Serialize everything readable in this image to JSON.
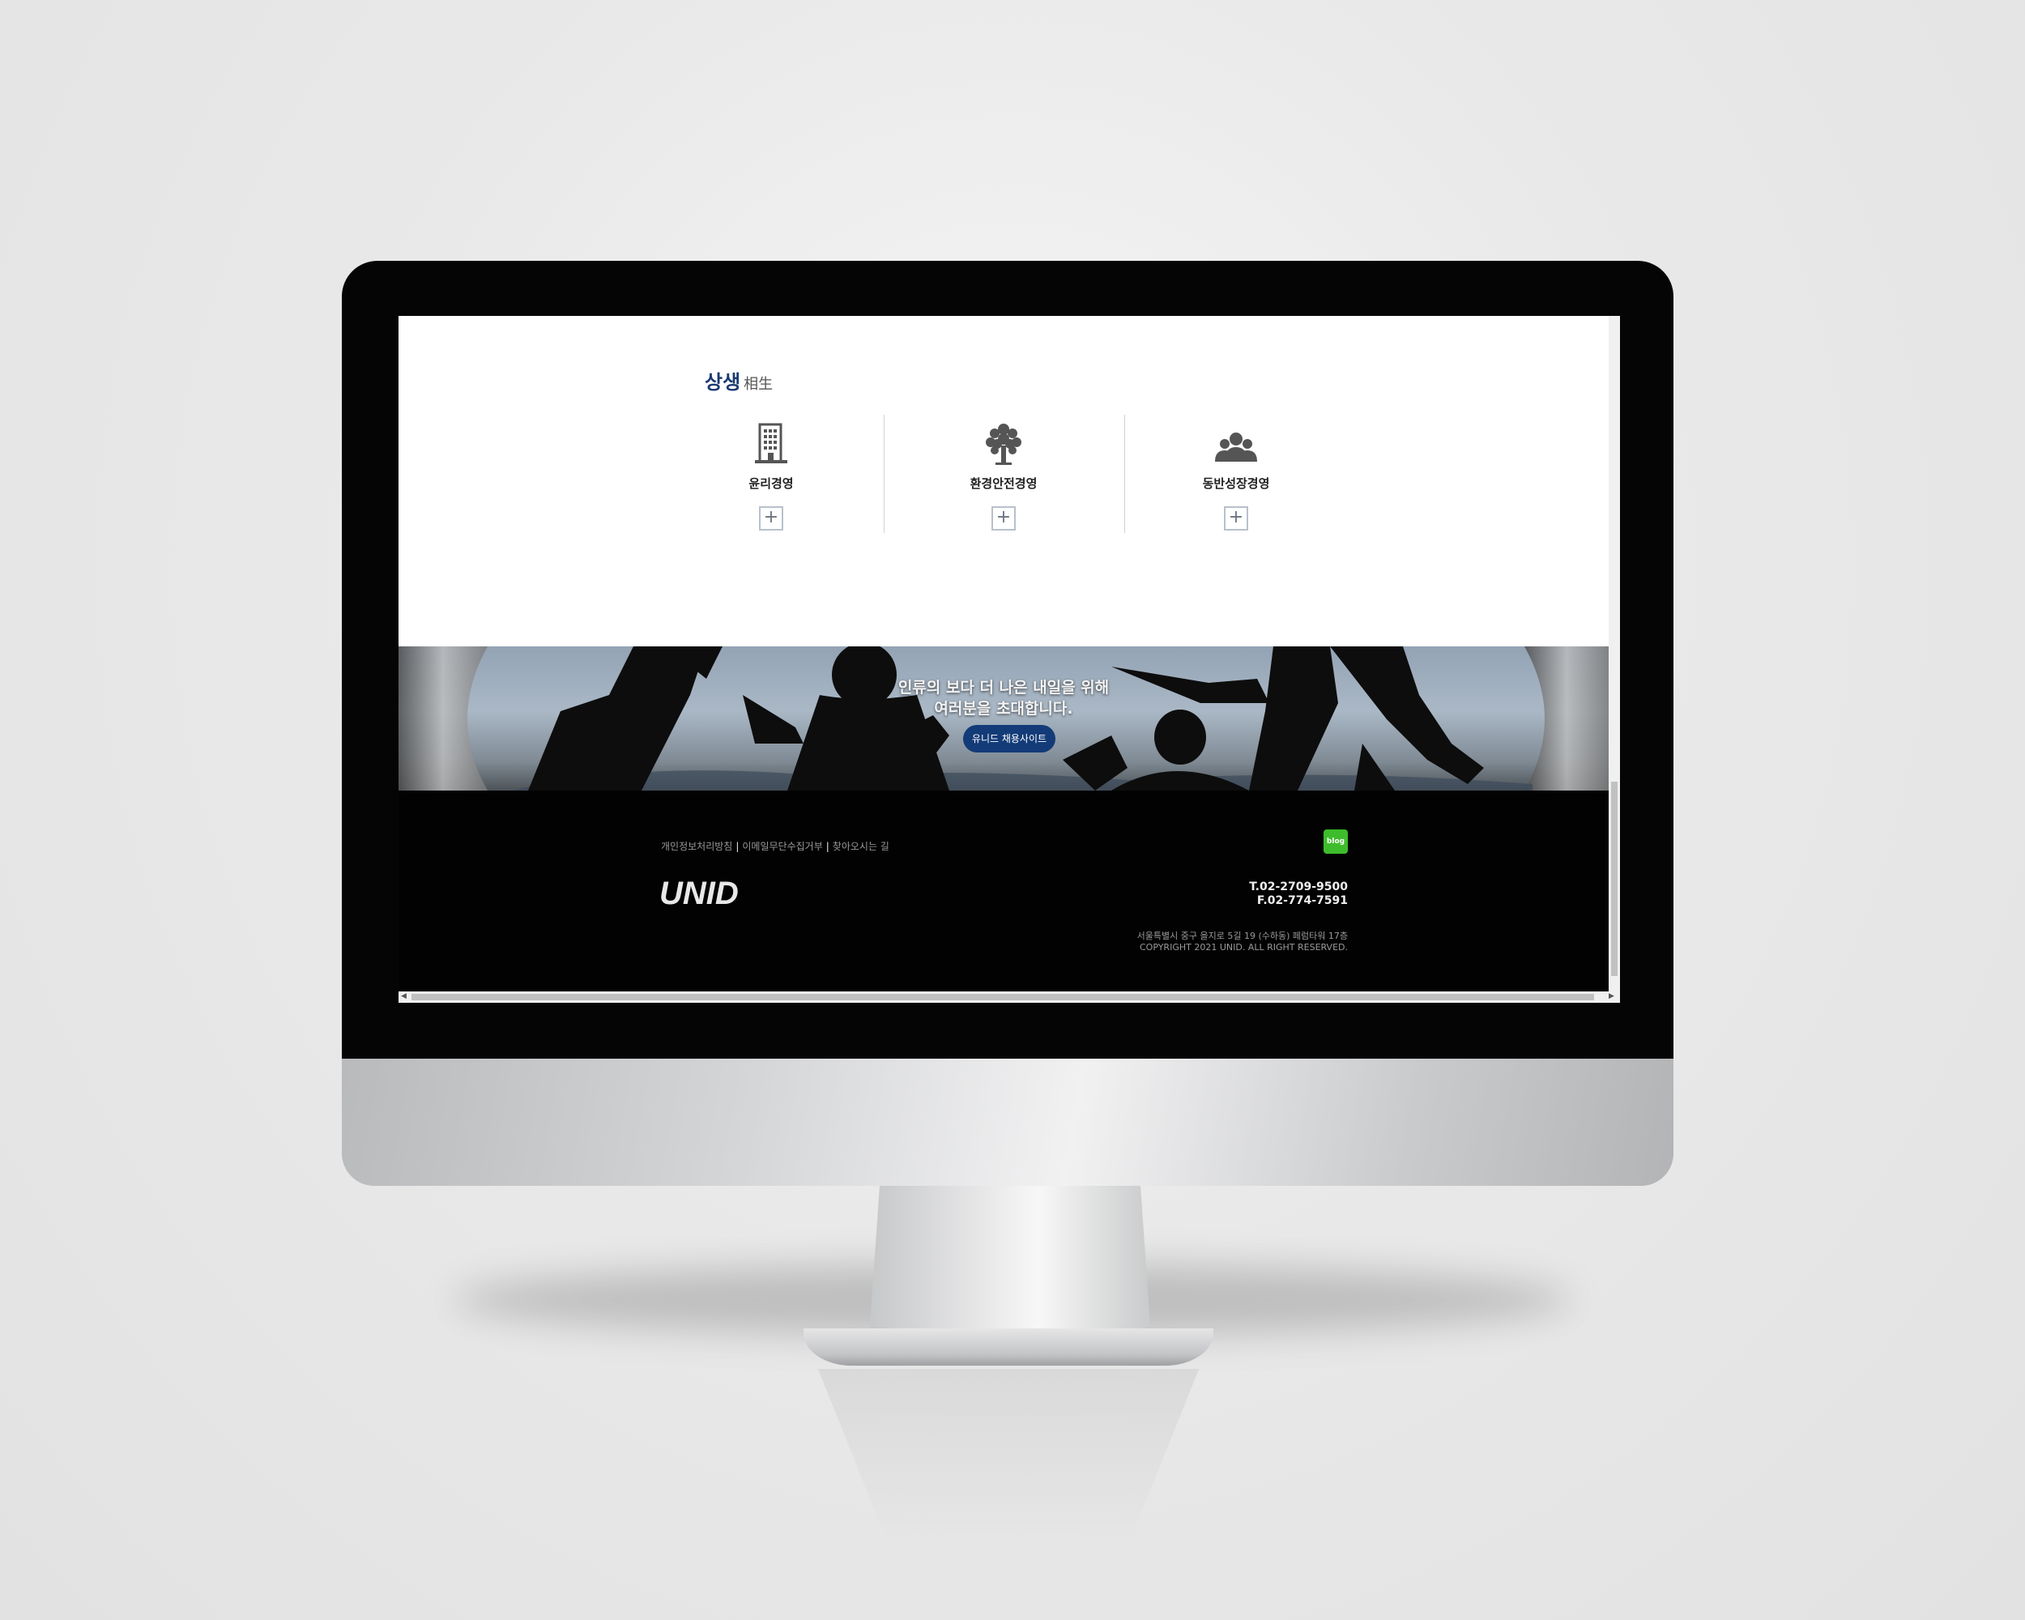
{
  "section": {
    "title_ko": "상생",
    "title_hanja": "相生"
  },
  "features": [
    {
      "label": "윤리경영",
      "icon": "building-icon",
      "more": "+"
    },
    {
      "label": "환경안전경영",
      "icon": "tree-icon",
      "more": "+"
    },
    {
      "label": "동반성장경영",
      "icon": "people-group-icon",
      "more": "+"
    }
  ],
  "banner": {
    "line1": "인류의 보다 더 나은 내일을 위해",
    "line2": "여러분을 초대합니다.",
    "button": "유니드 채용사이트"
  },
  "footer": {
    "links": [
      "개인정보처리방침",
      "이메일무단수집거부",
      "찾아오시는 길"
    ],
    "blog_label": "blog",
    "logo_text": "UNID",
    "tel": "T.02-2709-9500",
    "fax": "F.02-774-7591",
    "address": "서울특별시 중구 을지로 5길 19 (수하동) 페럼타워 17층",
    "copyright": "COPYRIGHT 2021 UNID. ALL RIGHT RESERVED."
  },
  "colors": {
    "title_navy": "#1b3a73",
    "button_navy": "#123b78",
    "blog_green": "#3ebd2c",
    "footer_bg": "#020202"
  }
}
